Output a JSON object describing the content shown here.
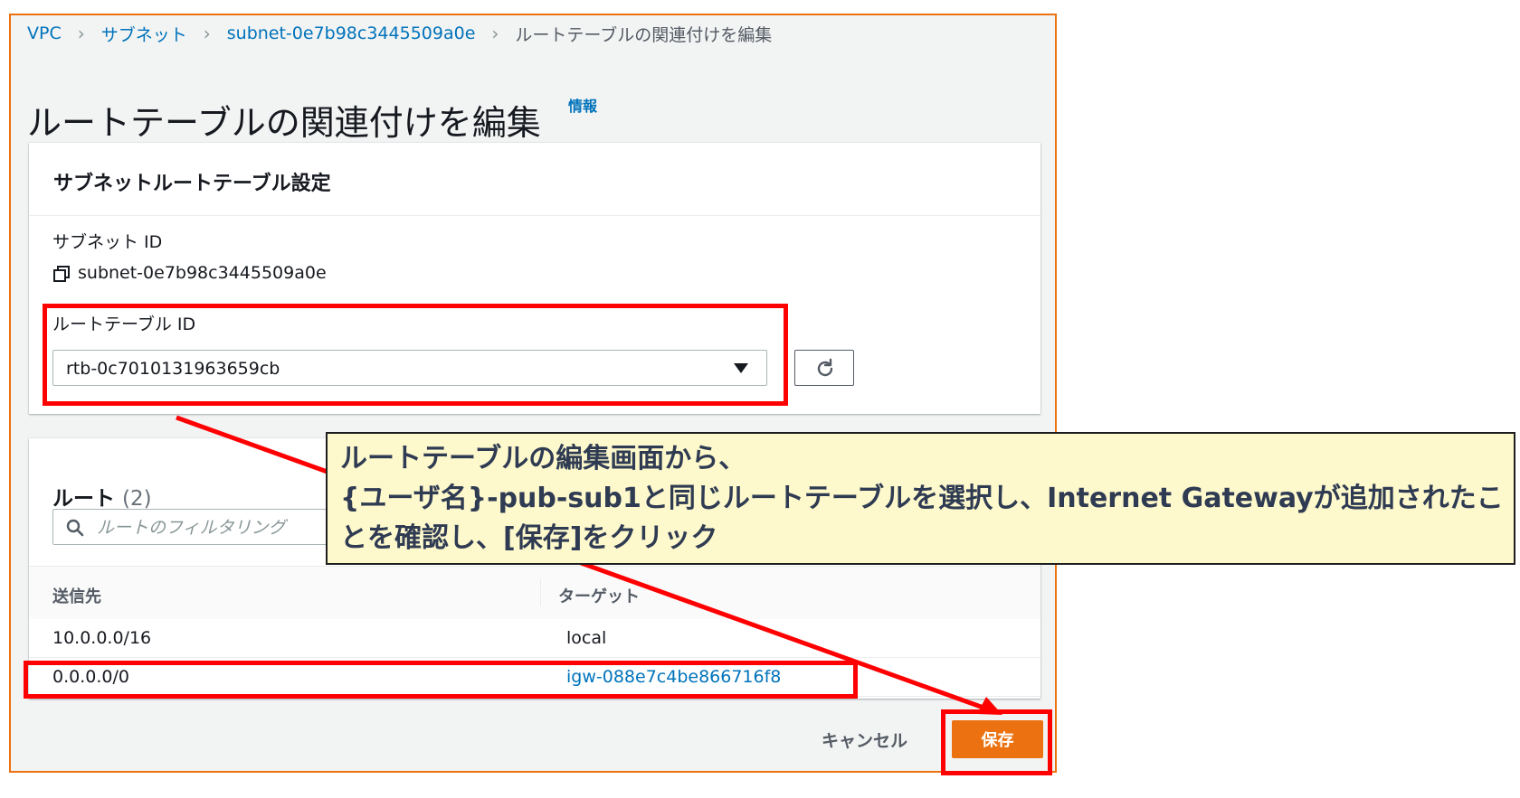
{
  "breadcrumb": {
    "items": [
      "VPC",
      "サブネット",
      "subnet-0e7b98c3445509a0e"
    ],
    "current": "ルートテーブルの関連付けを編集"
  },
  "page": {
    "title": "ルートテーブルの関連付けを編集",
    "info_link": "情報"
  },
  "settings_panel": {
    "title": "サブネットルートテーブル設定",
    "subnet_id_label": "サブネット ID",
    "subnet_id_value": "subnet-0e7b98c3445509a0e",
    "route_table_label": "ルートテーブル ID",
    "route_table_value": "rtb-0c7010131963659cb"
  },
  "routes_panel": {
    "title": "ルート",
    "count": "(2)",
    "filter_placeholder": "ルートのフィルタリング",
    "columns": [
      "送信先",
      "ターゲット"
    ],
    "rows": [
      {
        "destination": "10.0.0.0/16",
        "target": "local"
      },
      {
        "destination": "0.0.0.0/0",
        "target": "igw-088e7c4be866716f8"
      }
    ]
  },
  "footer": {
    "cancel_label": "キャンセル",
    "save_label": "保存"
  },
  "annotation": {
    "text": "ルートテーブルの編集画面から、\n{ユーザ名}-pub-sub1と同じルートテーブルを選択し、Internet Gatewayが追加されたことを確認し、[保存]をクリック"
  },
  "colors": {
    "accent": "#ec7211",
    "link": "#0073bb",
    "highlight": "#ff0000",
    "callout_bg": "#fef9cc"
  }
}
